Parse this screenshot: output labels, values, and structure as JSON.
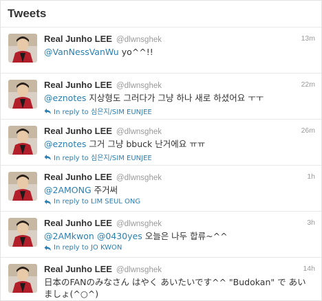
{
  "header": {
    "title": "Tweets"
  },
  "tweets": [
    {
      "name": "Real Junho LEE",
      "handle": "@dlwnsghek",
      "time": "13m",
      "mentions": [
        "@VanNessVanWu"
      ],
      "text": " yo^^!!",
      "reply": ""
    },
    {
      "name": "Real Junho LEE",
      "handle": "@dlwnsghek",
      "time": "22m",
      "mentions": [
        "@eznotes"
      ],
      "text": " 지상형도 그러다가 그냥 하나 새로 하셨어요 ㅜㅜ",
      "reply": "In reply to 심은지/SIM EUNJEE"
    },
    {
      "name": "Real Junho LEE",
      "handle": "@dlwnsghek",
      "time": "26m",
      "mentions": [
        "@eznotes"
      ],
      "text": " 그거 그냥 bbuck 난거에요 ㅠㅠ",
      "reply": "In reply to 심은지/SIM EUNJEE"
    },
    {
      "name": "Real Junho LEE",
      "handle": "@dlwnsghek",
      "time": "1h",
      "mentions": [
        "@2AMONG"
      ],
      "text": " 주거써",
      "reply": "In reply to LIM SEUL ONG"
    },
    {
      "name": "Real Junho LEE",
      "handle": "@dlwnsghek",
      "time": "3h",
      "mentions": [
        "@2AMkwon",
        "@0430yes"
      ],
      "text": " 오늘은 나두 합류~^^",
      "reply": "In reply to JO KWON"
    },
    {
      "name": "Real Junho LEE",
      "handle": "@dlwnsghek",
      "time": "14h",
      "mentions": [],
      "text": "日本のFANのみなさん はやく あいたいです^^ \"Budokan\" で あいましょ(^○^)",
      "reply": ""
    }
  ],
  "colors": {
    "link": "#2a7fb3",
    "muted": "#999999",
    "text": "#333333"
  },
  "icons": {
    "reply": "reply-arrow-icon"
  }
}
